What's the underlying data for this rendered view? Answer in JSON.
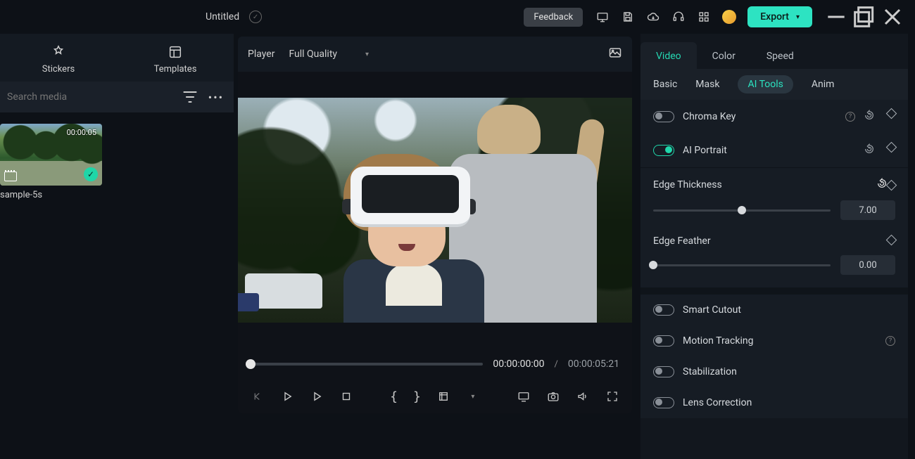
{
  "titlebar": {
    "title": "Untitled",
    "feedback": "Feedback",
    "export": "Export"
  },
  "left": {
    "tabs": {
      "stickers": "Stickers",
      "templates": "Templates"
    },
    "search_placeholder": "Search media",
    "clip": {
      "duration": "00:00:05",
      "name": "sample-5s"
    }
  },
  "player": {
    "label": "Player",
    "quality": "Full Quality",
    "current": "00:00:00:00",
    "total": "00:00:05:21",
    "sep": "/"
  },
  "right": {
    "tabs": {
      "video": "Video",
      "color": "Color",
      "speed": "Speed"
    },
    "subtabs": {
      "basic": "Basic",
      "mask": "Mask",
      "aitools": "AI Tools",
      "anim": "Anim"
    },
    "chroma": "Chroma Key",
    "portrait": "AI Portrait",
    "edge_thickness": {
      "label": "Edge Thickness",
      "value": "7.00"
    },
    "edge_feather": {
      "label": "Edge Feather",
      "value": "0.00"
    },
    "smart_cutout": "Smart Cutout",
    "motion_tracking": "Motion Tracking",
    "stabilization": "Stabilization",
    "lens_correction": "Lens Correction"
  }
}
